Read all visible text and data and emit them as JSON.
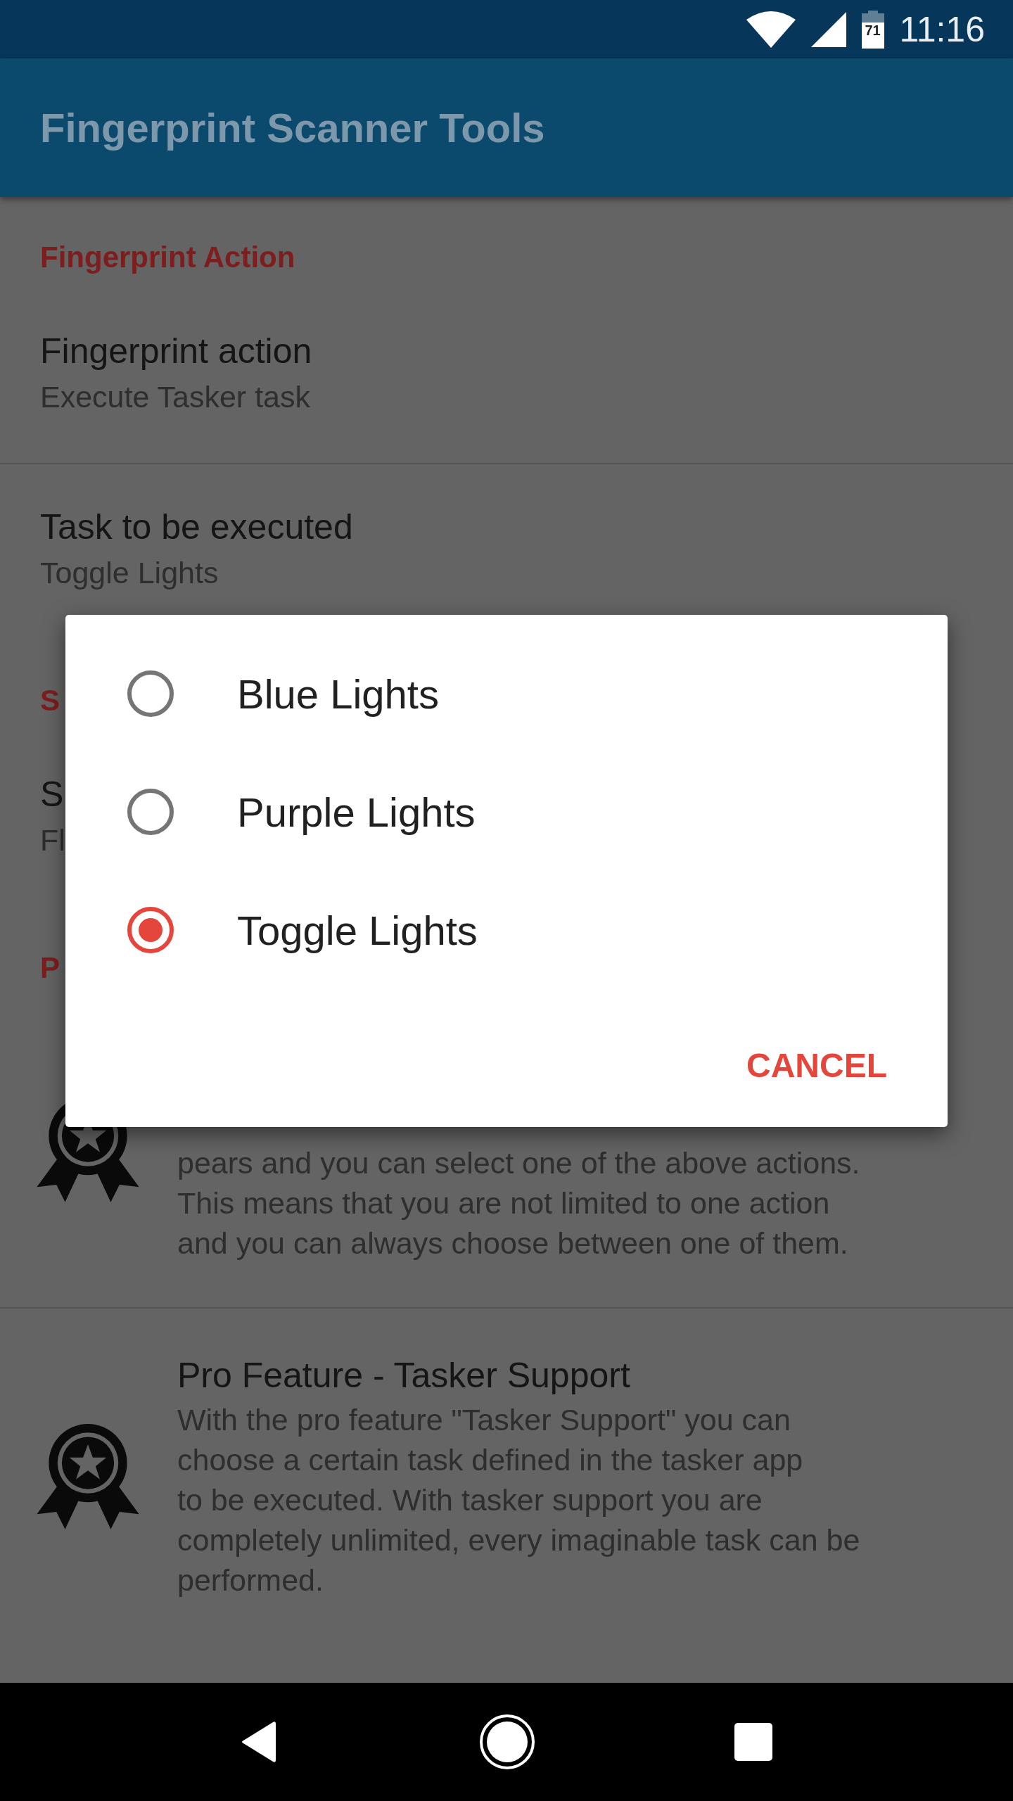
{
  "status_bar": {
    "battery": "71",
    "time": "11:16"
  },
  "app_bar": {
    "title": "Fingerprint Scanner Tools"
  },
  "sections": [
    {
      "kind": "header",
      "text": "Fingerprint Action"
    },
    {
      "kind": "setting",
      "title": "Fingerprint action",
      "summary": "Execute Tasker task",
      "divider": true
    },
    {
      "kind": "setting",
      "title": "Task to be executed",
      "summary": "Toggle Lights",
      "divider": false
    },
    {
      "kind": "header",
      "text": "S"
    },
    {
      "kind": "setting",
      "title": "S",
      "summary": "Fl",
      "divider": false
    },
    {
      "kind": "header",
      "text": "P"
    },
    {
      "kind": "pro",
      "lines": [
        "pears and you can select one of the above actions.",
        "This means that you are not limited to one action",
        "and you can always choose between one of them."
      ],
      "divider": true
    },
    {
      "kind": "pro",
      "title": "Pro Feature - Tasker Support",
      "lines": [
        "With the pro feature \"Tasker Support\" you can",
        "choose a certain task defined in the tasker app",
        "to be executed. With tasker support you are",
        "completely unlimited, every imaginable task can be",
        "performed."
      ],
      "divider": false
    }
  ],
  "dialog": {
    "options": [
      {
        "label": "Blue Lights",
        "selected": false
      },
      {
        "label": "Purple Lights",
        "selected": false
      },
      {
        "label": "Toggle Lights",
        "selected": true
      }
    ],
    "cancel": "CANCEL"
  }
}
